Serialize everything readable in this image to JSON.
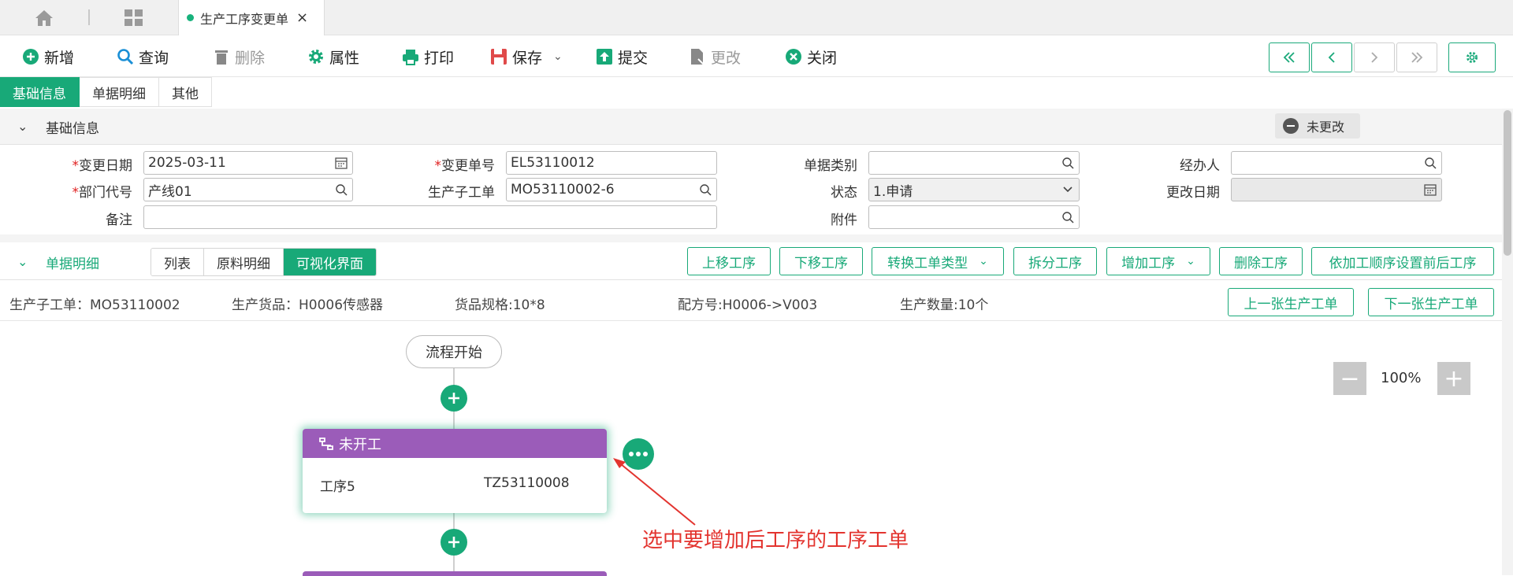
{
  "tabstrip": {
    "tab_title": "生产工序变更单",
    "close": "×"
  },
  "toolbar": {
    "new": "新增",
    "query": "查询",
    "delete": "删除",
    "properties": "属性",
    "print": "打印",
    "save": "保存",
    "submit": "提交",
    "modify": "更改",
    "close": "关闭"
  },
  "section_tabs": [
    "基础信息",
    "单据明细",
    "其他"
  ],
  "basic": {
    "title": "基础信息",
    "status": "未更改",
    "fields": {
      "change_date_label": "变更日期",
      "change_date": "2025-03-11",
      "change_no_label": "变更单号",
      "change_no": "EL53110012",
      "doc_type_label": "单据类别",
      "doc_type": "",
      "handler_label": "经办人",
      "handler": "",
      "dept_label": "部门代号",
      "dept": "产线01",
      "sub_order_label": "生产子工单",
      "sub_order": "MO53110002-6",
      "state_label": "状态",
      "state": "1.申请",
      "modify_date_label": "更改日期",
      "modify_date": "",
      "remark_label": "备注",
      "remark": "",
      "attach_label": "附件",
      "attach": ""
    },
    "required_mark": "*"
  },
  "detail": {
    "title": "单据明细",
    "subtabs": [
      "列表",
      "原料明细",
      "可视化界面"
    ],
    "actions": {
      "move_up": "上移工序",
      "move_down": "下移工序",
      "convert_type": "转换工单类型",
      "split": "拆分工序",
      "add": "增加工序",
      "remove": "删除工序",
      "set_order": "依加工顺序设置前后工序"
    },
    "info": {
      "sub_order": "生产子工单：MO53110002",
      "goods": "生产货品：H0006传感器",
      "spec": "货品规格:10*8",
      "formula": "配方号:H0006->V003",
      "qty": "生产数量:10个"
    },
    "prev_order": "上一张生产工单",
    "next_order": "下一张生产工单"
  },
  "flow": {
    "start": "流程开始",
    "zoom": "100%",
    "zoom_minus": "−",
    "zoom_plus": "+",
    "card": {
      "status": "未开工",
      "name": "工序5",
      "code": "TZ53110008"
    },
    "annotation": "选中要增加后工序的工序工单"
  },
  "colors": {
    "accent": "#18a978",
    "card_header": "#9b5cb9",
    "annotation": "#e3342f"
  }
}
